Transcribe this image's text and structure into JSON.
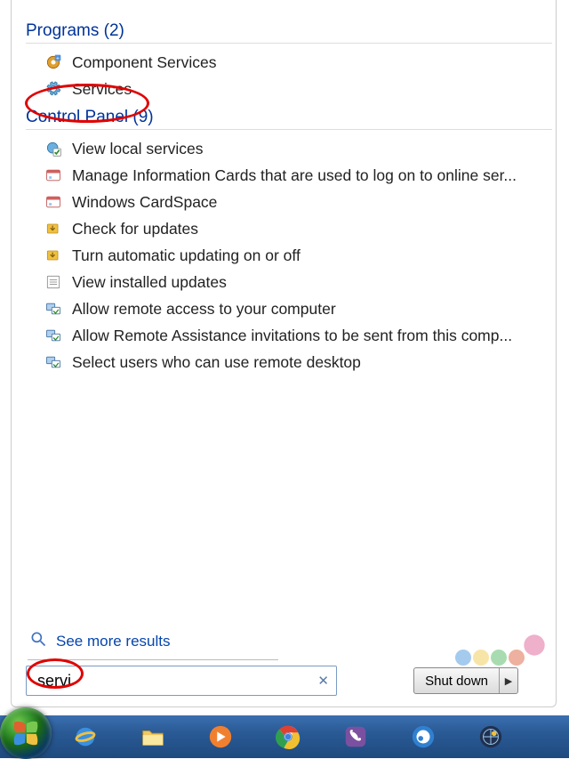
{
  "sections": [
    {
      "header": "Programs (2)",
      "items": [
        {
          "icon": "gear-plus-icon",
          "label": "Component Services"
        },
        {
          "icon": "gear-icon",
          "label": "Services"
        }
      ]
    },
    {
      "header": "Control Panel (9)",
      "items": [
        {
          "icon": "gear-check-icon",
          "label": "View local services"
        },
        {
          "icon": "card-icon",
          "label": "Manage Information Cards that are used to log on to online ser..."
        },
        {
          "icon": "card-icon",
          "label": "Windows CardSpace"
        },
        {
          "icon": "update-icon",
          "label": "Check for updates"
        },
        {
          "icon": "update-icon",
          "label": "Turn automatic updating on or off"
        },
        {
          "icon": "list-icon",
          "label": "View installed updates"
        },
        {
          "icon": "remote-icon",
          "label": "Allow remote access to your computer"
        },
        {
          "icon": "remote-icon",
          "label": "Allow Remote Assistance invitations to be sent from this comp..."
        },
        {
          "icon": "remote-icon",
          "label": "Select users who can use remote desktop"
        }
      ]
    }
  ],
  "see_more": "See more results",
  "search": {
    "value": "servi"
  },
  "shutdown_label": "Shut down",
  "taskbar_items": [
    "start-button",
    "internet-explorer-icon",
    "file-explorer-icon",
    "media-player-icon",
    "chrome-icon",
    "viber-icon",
    "weibo-icon",
    "app-icon"
  ]
}
